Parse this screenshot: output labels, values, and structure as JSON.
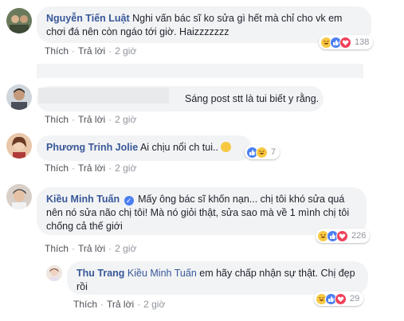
{
  "actions": {
    "like": "Thích",
    "reply": "Trả lời",
    "separator": "·"
  },
  "comments": [
    {
      "author": "Nguyễn Tiến Luật",
      "text": "Nghi vấn bác sĩ ko sửa gì hết mà chỉ cho vk em chơi đá nên còn ngáo tới giờ. Haizzzzzzz",
      "time": "2 giờ",
      "reaction_count": "138"
    },
    {
      "author": "",
      "text": "Sáng post stt là tui biết y rằng.",
      "time": "2 giờ",
      "reaction_count": ""
    },
    {
      "author": "Phương Trinh Jolie",
      "text": "Ai chịu nổi ch tui..",
      "time": "2 giờ",
      "reaction_count": "7"
    },
    {
      "author": "Kiều Minh Tuấn",
      "text": "Mấy ông bác sĩ khốn nạn... chị tôi khó sửa quá nên nó sửa não chị tôi! Mà nó giỏi thật, sửa sao mà về 1 mình chị tôi chống cả thế giới",
      "time": "2 giờ",
      "reaction_count": "226"
    },
    {
      "author": "Thu Trang",
      "mention": "Kiều Minh Tuấn",
      "text": "em hãy chấp nhận sự thật. Chị đẹp rồi",
      "time": "2 giờ",
      "reaction_count": "29"
    }
  ],
  "colors": {
    "name": "#385898",
    "bubble": "#f2f3f5",
    "meta": "#90949c",
    "like": "#4a7ef3",
    "love": "#f0405a",
    "haha": "#f7c843"
  },
  "icons": [
    "haha-icon",
    "like-icon",
    "love-icon",
    "verified-icon"
  ]
}
